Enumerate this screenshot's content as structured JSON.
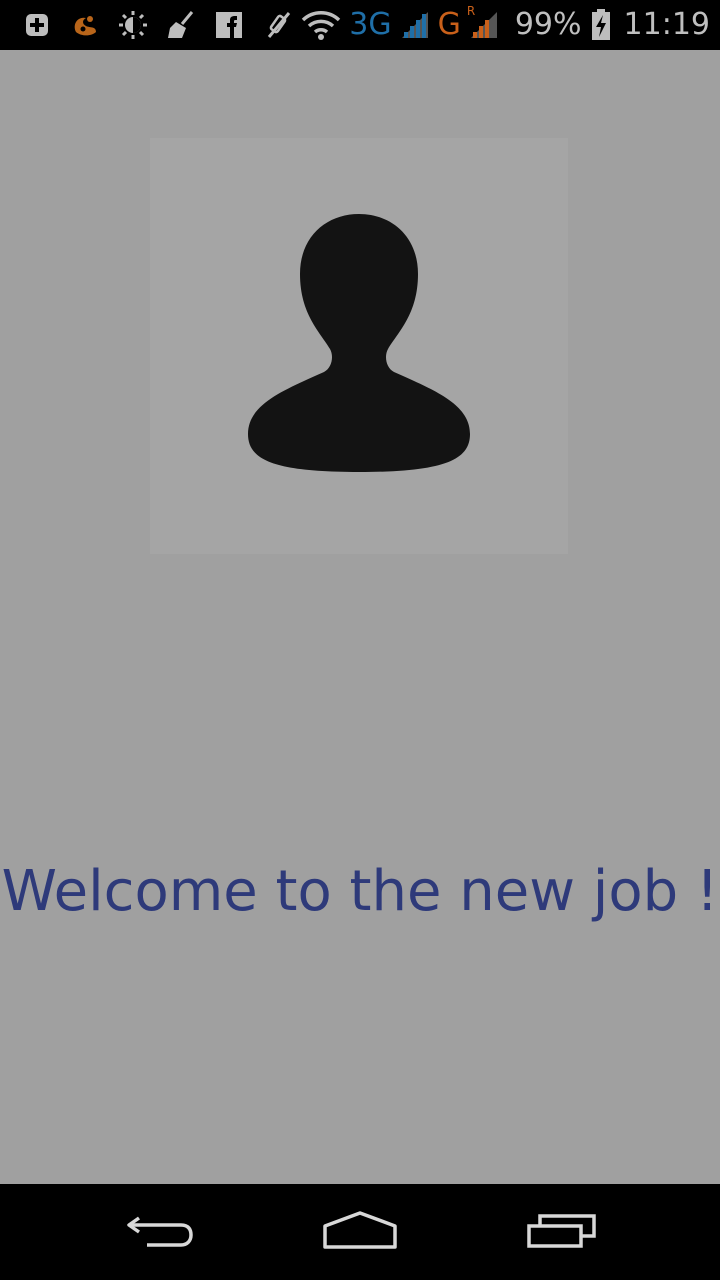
{
  "status_bar": {
    "icons_left": [
      "add-notification-icon",
      "uc-browser-icon",
      "brightness-icon",
      "cleaner-broom-icon",
      "facebook-icon"
    ],
    "icons_right": [
      "mute-icon",
      "wifi-icon"
    ],
    "network_1": "3G",
    "network_2": "G",
    "roaming_indicator": "R",
    "battery": "99%",
    "time": "11:19",
    "colors": {
      "network_1": "#1f6fa8",
      "network_2": "#c9601a"
    }
  },
  "main": {
    "avatar_icon": "person-silhouette-icon",
    "welcome_text": "Welcome to the new job !"
  },
  "nav_bar": {
    "buttons": [
      "back-icon",
      "home-icon",
      "recents-icon"
    ]
  },
  "colors": {
    "background": "#a0a0a0",
    "welcome_text": "#2e3a7a"
  }
}
